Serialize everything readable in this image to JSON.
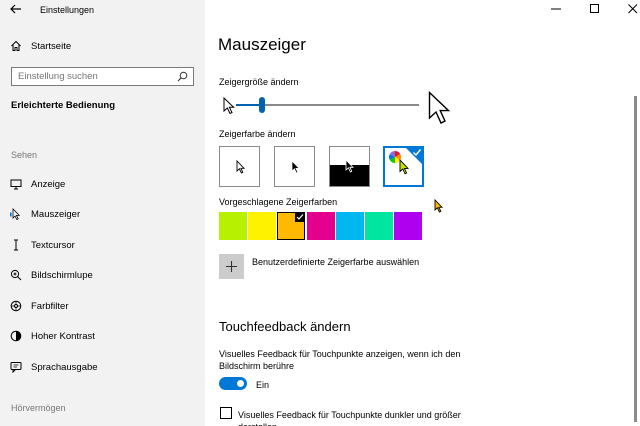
{
  "app": {
    "title": "Einstellungen"
  },
  "sidebar": {
    "home_label": "Startseite",
    "search_placeholder": "Einstellung suchen",
    "breadcrumb": "Erleichterte Bedienung",
    "section_sehen": "Sehen",
    "section_hoeren": "Hörvermögen",
    "items": [
      {
        "label": "Anzeige",
        "icon": "monitor-icon",
        "active": false
      },
      {
        "label": "Mauszeiger",
        "icon": "mouse-pointer-icon",
        "active": true
      },
      {
        "label": "Textcursor",
        "icon": "text-cursor-icon",
        "active": false
      },
      {
        "label": "Bildschirmlupe",
        "icon": "magnifier-icon",
        "active": false
      },
      {
        "label": "Farbfilter",
        "icon": "color-filter-icon",
        "active": false
      },
      {
        "label": "Hoher Kontrast",
        "icon": "high-contrast-icon",
        "active": false
      },
      {
        "label": "Sprachausgabe",
        "icon": "narrator-icon",
        "active": false
      }
    ]
  },
  "main": {
    "title": "Mauszeiger",
    "size_label": "Zeigergröße ändern",
    "size_level": 0.2,
    "color_label": "Zeigerfarbe ändern",
    "color_options": [
      "white",
      "black",
      "inverted",
      "custom"
    ],
    "color_selected_index": 3,
    "suggested_label": "Vorgeschlagene Zeigerfarben",
    "suggested_colors": [
      "#b7f000",
      "#fff200",
      "#ffb900",
      "#e3008c",
      "#00b7f0",
      "#00e5a0",
      "#b000f0"
    ],
    "suggested_selected_index": 2,
    "custom_color_label": "Benutzerdefinierte Zeigerfarbe auswählen",
    "touch_heading": "Touchfeedback ändern",
    "touch_desc": "Visuelles Feedback für Touchpunkte anzeigen, wenn ich den Bildschirm berühre",
    "touch_toggle_label": "Ein",
    "touch_toggle_on": true,
    "dark_feedback_label": "Visuelles Feedback für Touchpunkte dunkler und größer darstellen",
    "dark_feedback_checked": false
  },
  "colors": {
    "accent": "#0078d7",
    "sidebar_bg": "#f2f2f2"
  }
}
